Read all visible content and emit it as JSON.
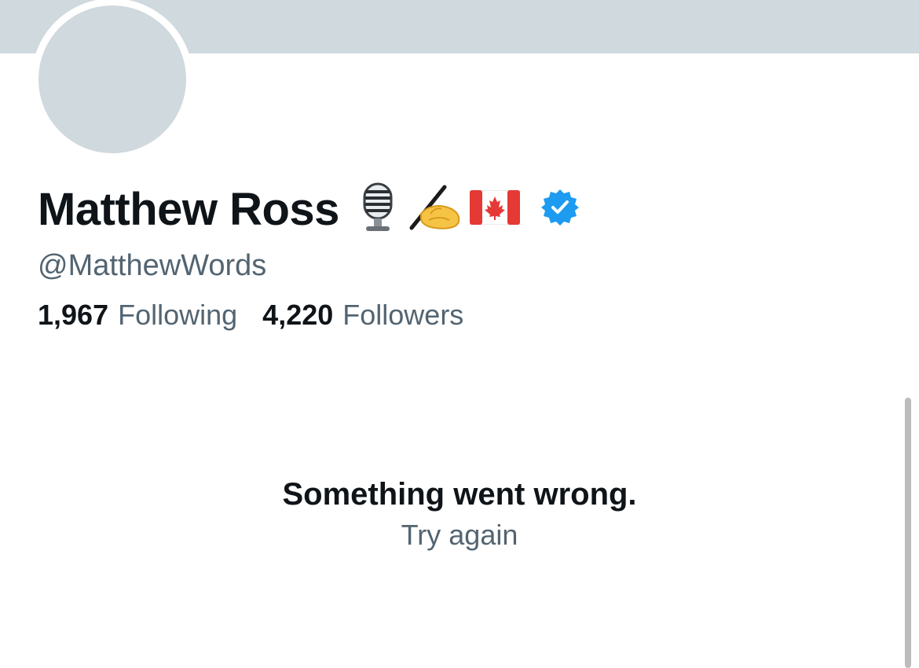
{
  "profile": {
    "display_name": "Matthew Ross",
    "handle": "@MatthewWords",
    "name_emojis": [
      "studio-microphone-emoji",
      "writing-hand-emoji",
      "canada-flag-emoji"
    ],
    "verified": true
  },
  "stats": {
    "following_count": "1,967",
    "following_label": "Following",
    "followers_count": "4,220",
    "followers_label": "Followers"
  },
  "error": {
    "title": "Something went wrong.",
    "action": "Try again"
  },
  "colors": {
    "banner": "#cfd9de",
    "avatar_placeholder": "#cfd9de",
    "text_primary": "#0f1419",
    "text_secondary": "#536471",
    "verified_badge": "#1d9bf0"
  }
}
